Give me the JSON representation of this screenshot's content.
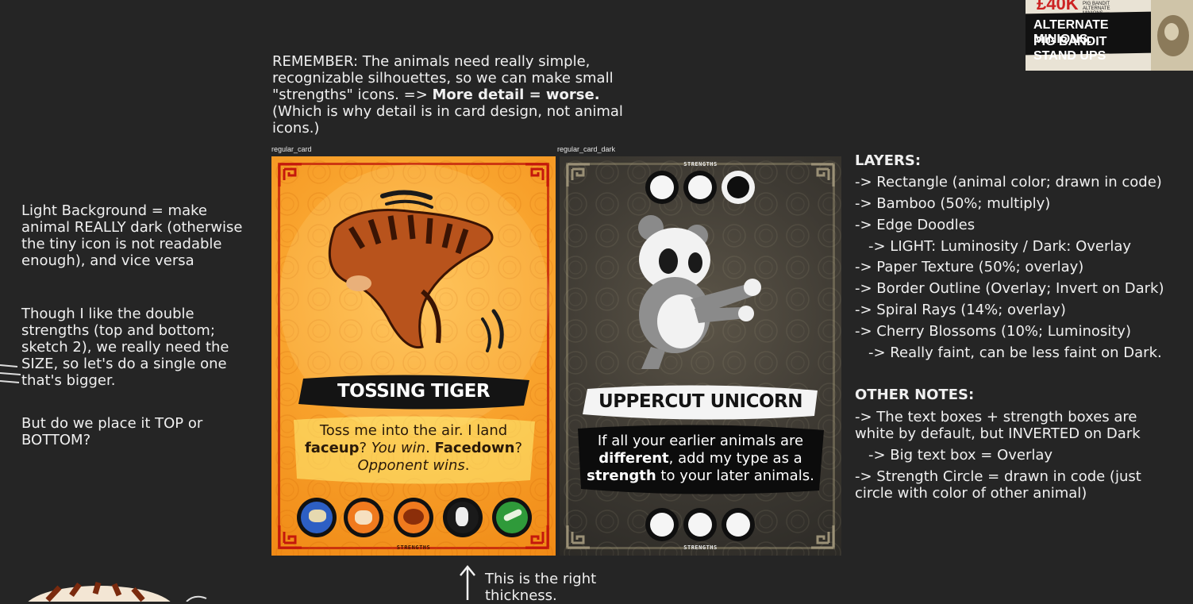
{
  "thumbnail": {
    "amount": "£40K",
    "small_lines": [
      "PIG BANDIT",
      "ALTERNATE MINIONS"
    ],
    "title_line1": "ALTERNATE MINIONS:",
    "title_line2": "PIG BANDIT STAND UPS"
  },
  "notes": {
    "remember": {
      "part1": "REMEMBER: The animals need really simple, recognizable silhouettes, so we can make small \"strengths\" icons. => ",
      "bold": "More detail = worse.",
      "part2": " (Which is why detail is in card design, not animal icons.)"
    },
    "light_bg": "Light Background = make animal REALLY dark (otherwise the tiny icon is not readable enough), and vice versa",
    "double_strengths": "Though I like the double strengths (top and bottom; sketch 2), we really need the SIZE, so let's do a single one that's bigger.",
    "placement": "But do we place it TOP or BOTTOM?",
    "thickness": "This is the right thickness."
  },
  "frames": {
    "light_label": "regular_card",
    "dark_label": "regular_card_dark"
  },
  "light_card": {
    "title": "TOSSING TIGER",
    "strengths_label": "STRENGTHS",
    "text": {
      "t1": "Toss me into the air. I land ",
      "b1": "faceup",
      "t2": "? ",
      "i1": "You win",
      "t3": ". ",
      "b2": "Facedown",
      "t4": "? ",
      "i2": "Opponent wins",
      "t5": "."
    },
    "strength_icons": [
      "blue-animal-icon",
      "orange-tiger-icon",
      "orange-curled-tiger-icon",
      "black-panda-icon",
      "green-mantis-icon"
    ],
    "colors": {
      "bg": "#f7a02c",
      "border": "#c4180c",
      "stripe": "#5a1d08"
    }
  },
  "dark_card": {
    "title": "UPPERCUT UNICORN",
    "strengths_top_label": "STRENGTHS",
    "strengths_bottom_label": "STRENGTHS",
    "text": {
      "t1": "If all your earlier animals are ",
      "b1": "different",
      "t2": ", add my type as a ",
      "b2": "strength",
      "t3": " to your later animals."
    },
    "colors": {
      "bg": "#3e3a33",
      "panda_white": "#f2f2f2",
      "panda_grey": "#8a8a8a"
    }
  },
  "layers": {
    "heading": "LAYERS:",
    "items": [
      "-> Rectangle (animal color; drawn in code)",
      "-> Bamboo (50%; multiply)",
      "-> Edge Doodles",
      "-> LIGHT: Luminosity / Dark: Overlay",
      "-> Paper Texture (50%; overlay)",
      "-> Border Outline (Overlay; Invert on Dark)",
      "-> Spiral Rays (14%; overlay)",
      "-> Cherry Blossoms (10%; Luminosity)",
      "-> Really faint, can be less faint on Dark."
    ]
  },
  "other_notes": {
    "heading": "OTHER NOTES:",
    "items": [
      "-> The text boxes + strength boxes are white by default, but INVERTED on Dark",
      "-> Big text box = Overlay",
      "-> Strength Circle = drawn in code (just circle with color of other animal)"
    ]
  }
}
